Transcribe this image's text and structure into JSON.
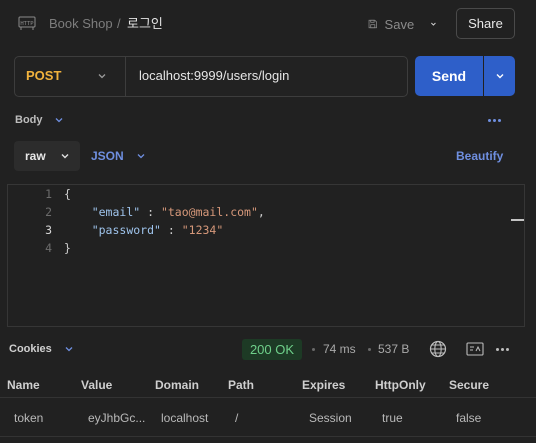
{
  "header": {
    "breadcrumb_parent": "Book Shop",
    "breadcrumb_separator": "/",
    "request_name": "로그인",
    "save_label": "Save",
    "share_label": "Share"
  },
  "request": {
    "method": "POST",
    "url": "localhost:9999/users/login",
    "send_label": "Send"
  },
  "body_section": {
    "label": "Body",
    "mode": "raw",
    "format": "JSON",
    "beautify_label": "Beautify"
  },
  "editor": {
    "line_numbers": [
      "1",
      "2",
      "3",
      "4"
    ],
    "open_brace": "{",
    "close_brace": "}",
    "email_key": "\"email\"",
    "email_value": "\"tao@mail.com\"",
    "password_key": "\"password\"",
    "password_value": "\"1234\""
  },
  "response": {
    "tab_label": "Cookies",
    "status": "200 OK",
    "time": "74 ms",
    "size": "537 B",
    "status_color": "#6fd08a"
  },
  "cookies_table": {
    "columns": [
      "Name",
      "Value",
      "Domain",
      "Path",
      "Expires",
      "HttpOnly",
      "Secure"
    ],
    "rows": [
      [
        "token",
        "eyJhbGc...",
        "localhost",
        "/",
        "Session",
        "true",
        "false"
      ]
    ]
  },
  "colors": {
    "accent": "#2e5fc9",
    "method": "#f2b33d",
    "link": "#6f8fe0"
  }
}
